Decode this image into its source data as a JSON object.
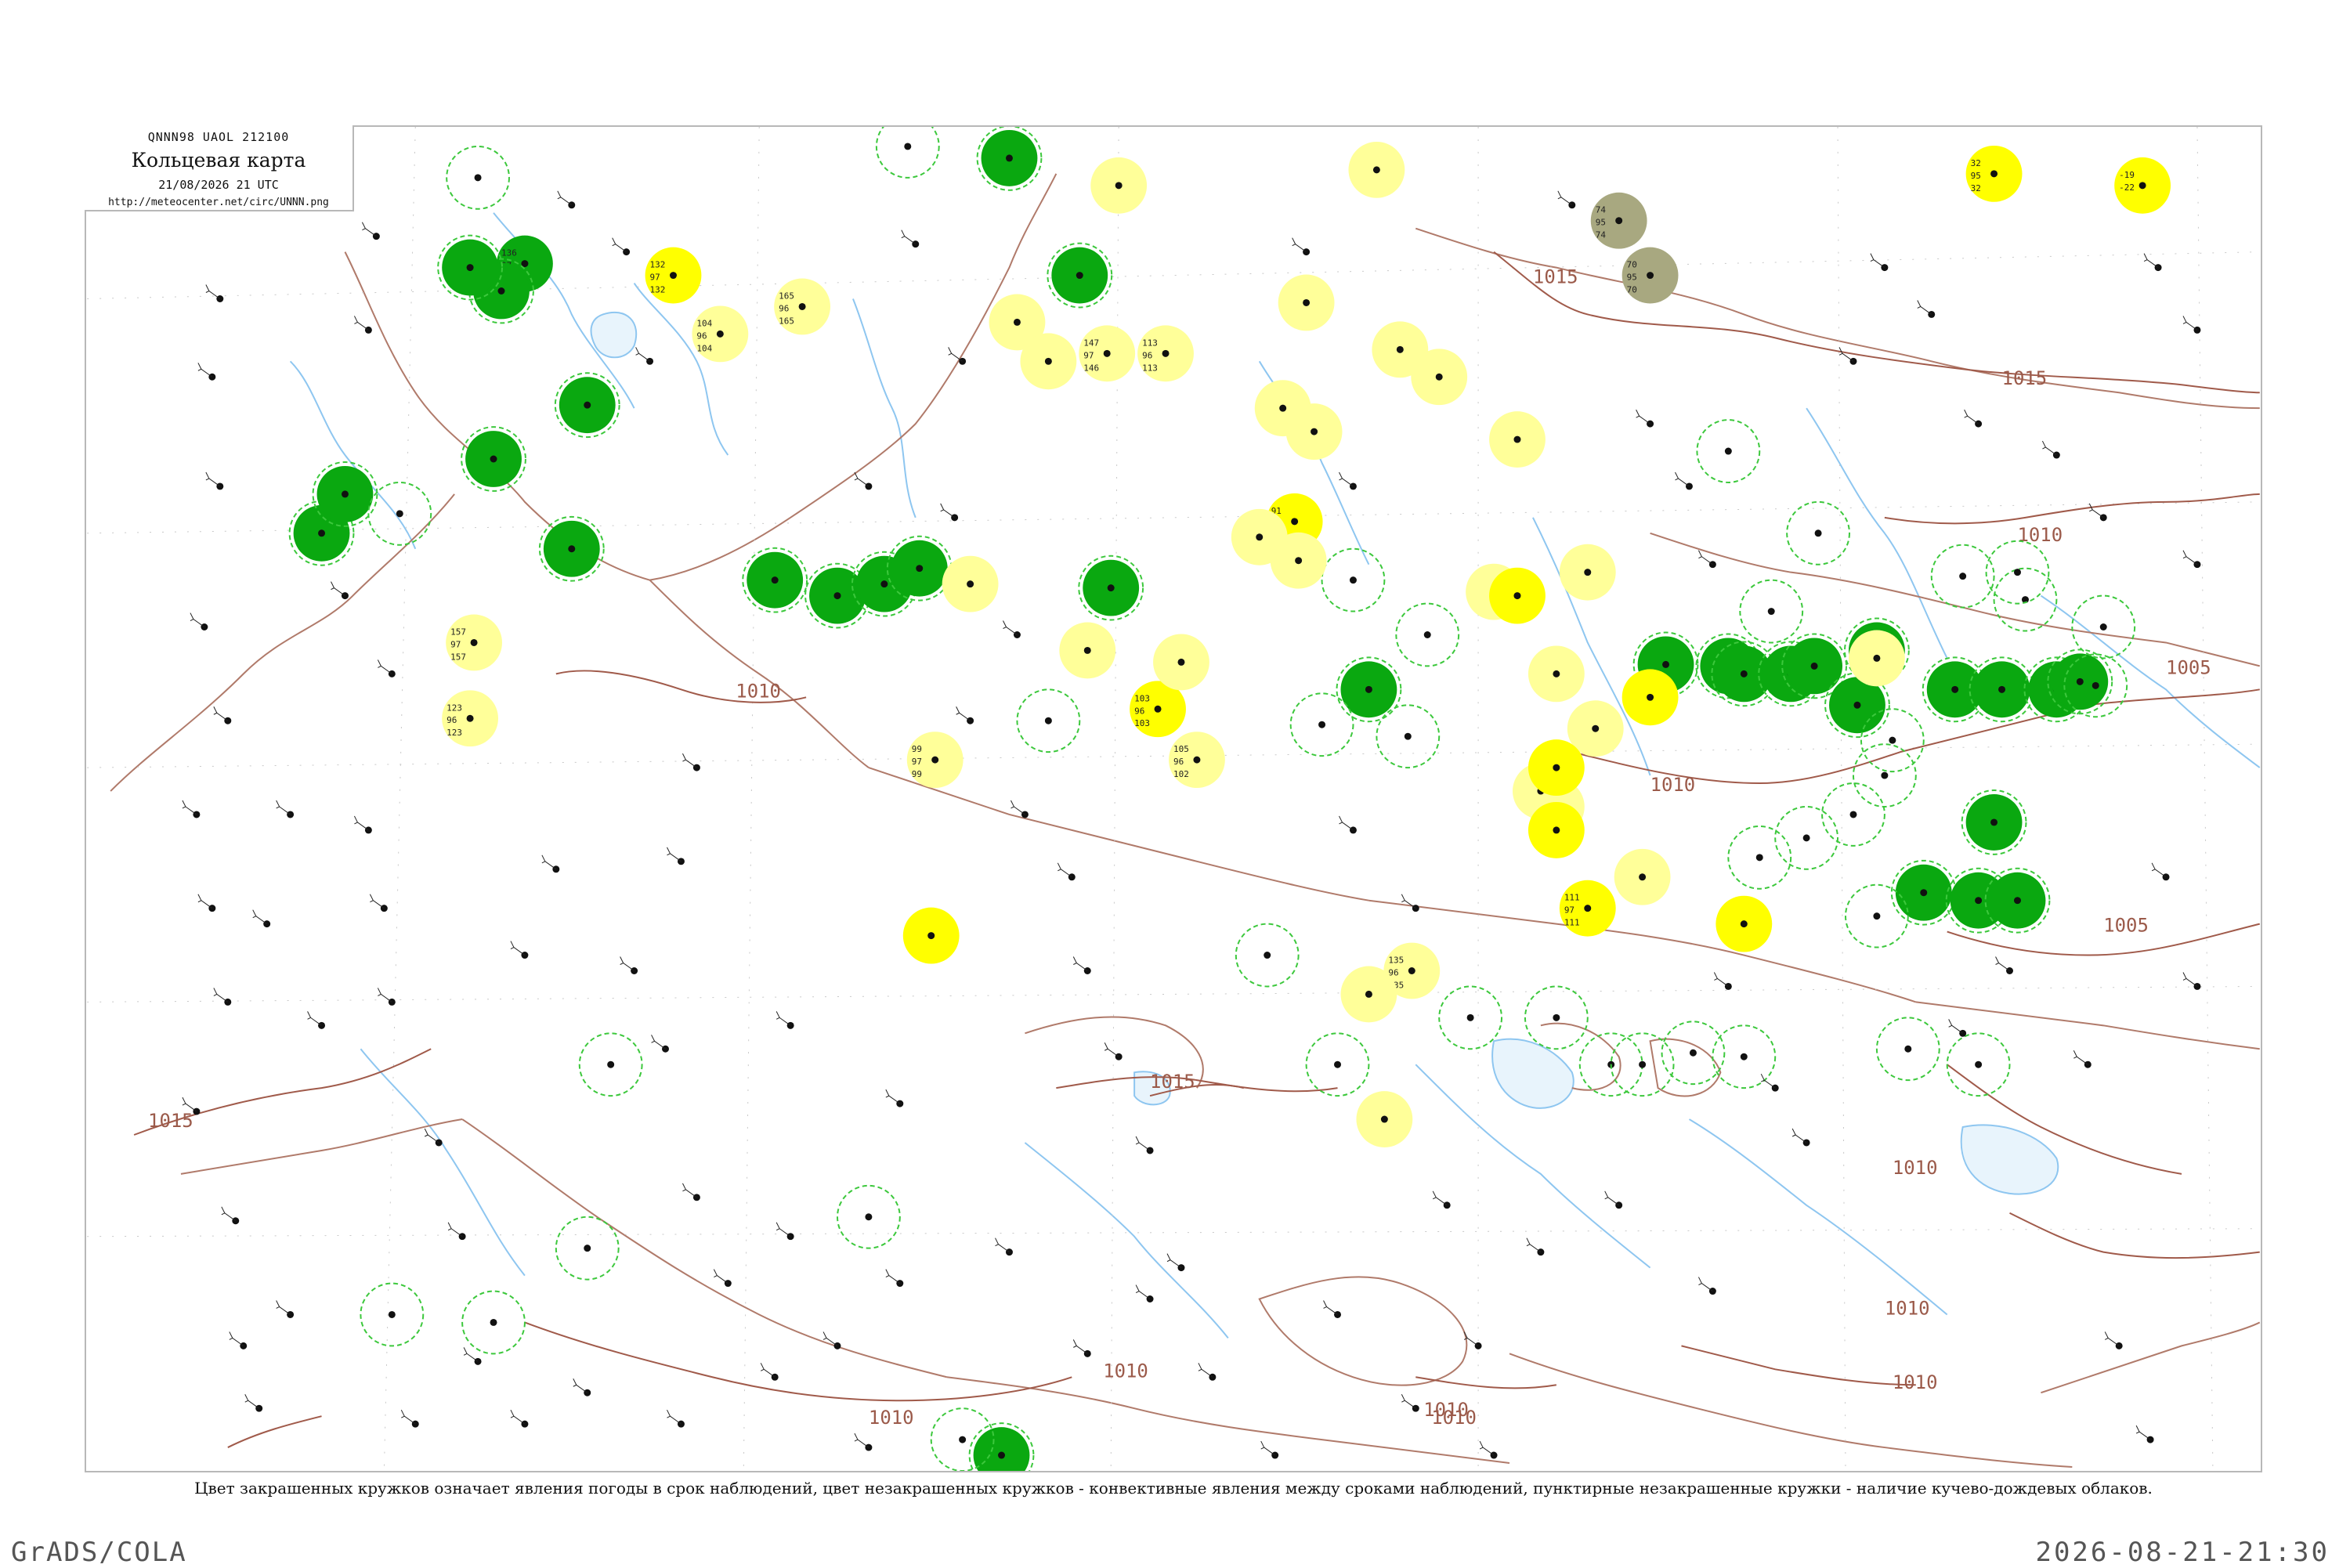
{
  "header": {
    "code": "QNNN98  UAOL  212100",
    "title": "Кольцевая карта",
    "datetime": "21/08/2026 21 UTC",
    "url": "http://meteocenter.net/circ/UNNN.png"
  },
  "caption": "Цвет закрашенных кружков означает явления погоды в срок наблюдений, цвет незакрашенных кружков - конвективные явления между сроками наблюдений, пунктирные незакрашенные кружки - наличие кучево-дождевых облаков.",
  "footer": {
    "left": "GrADS/COLA",
    "right": "2026-08-21-21:30"
  },
  "isobars": {
    "labels": [
      "1015",
      "1015",
      "1015",
      "1010",
      "1010",
      "1010",
      "1010",
      "1010",
      "1010",
      "1010",
      "1005",
      "1005",
      "1015",
      "1010",
      "1010",
      "1010"
    ]
  },
  "colors": {
    "rain": "#0aa810",
    "showers": "#ffff00",
    "light": "#ffff99",
    "fog": "#a8a880",
    "convective_ring": "#3cc83c",
    "isobar": "#a05a4a",
    "river": "#8ec6f0"
  },
  "stations": [
    {
      "v": [
        "136",
        "97",
        "136"
      ],
      "c": "rain"
    },
    {
      "v": [
        "132",
        "97",
        "132"
      ],
      "c": "showers"
    },
    {
      "v": [
        "104",
        "96",
        "104"
      ],
      "c": "light"
    },
    {
      "v": [
        "165",
        "96",
        "165"
      ],
      "c": "light"
    },
    {
      "v": [
        "147",
        "97",
        "146"
      ],
      "c": "light"
    },
    {
      "v": [
        "113",
        "96",
        "113"
      ],
      "c": "light"
    },
    {
      "v": [
        "91",
        "93",
        "90"
      ],
      "c": "showers"
    },
    {
      "v": [
        "103",
        "96",
        "103"
      ],
      "c": "showers"
    },
    {
      "v": [
        "105",
        "96",
        "102"
      ],
      "c": "light"
    },
    {
      "v": [
        "123",
        "96",
        "123"
      ],
      "c": "light"
    },
    {
      "v": [
        "157",
        "97",
        "157"
      ],
      "c": "light"
    },
    {
      "v": [
        "99",
        "97",
        "99"
      ],
      "c": "light"
    },
    {
      "v": [
        "135",
        "96",
        "135"
      ],
      "c": "light"
    },
    {
      "v": [
        "111",
        "97",
        "111"
      ],
      "c": "showers"
    },
    {
      "v": [
        "32",
        "95",
        "32"
      ],
      "c": "showers"
    },
    {
      "v": [
        "-19",
        "-22",
        ""
      ],
      "c": "showers"
    },
    {
      "v": [
        "74",
        "95",
        "74"
      ],
      "c": "fog"
    },
    {
      "v": [
        "70",
        "95",
        "70"
      ],
      "c": "fog"
    }
  ]
}
